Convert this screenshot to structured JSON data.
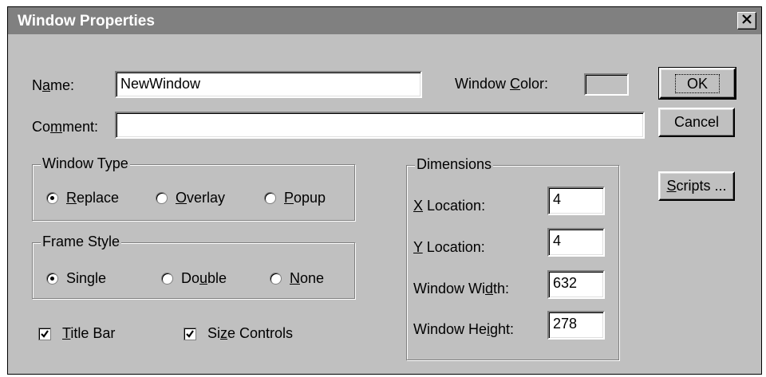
{
  "window": {
    "title": "Window Properties",
    "close_glyph": "✕"
  },
  "name": {
    "label_pre": "N",
    "label_u": "a",
    "label_post": "me:",
    "value": "NewWindow"
  },
  "window_color": {
    "label_pre": "Window ",
    "label_u": "C",
    "label_post": "olor:",
    "color": "#c0c0c0"
  },
  "comment": {
    "label_pre": "Co",
    "label_u": "m",
    "label_post": "ment:",
    "value": ""
  },
  "buttons": {
    "ok": "OK",
    "cancel": "Cancel",
    "scripts_u": "S",
    "scripts_post": "cripts ..."
  },
  "window_type": {
    "title": "Window Type",
    "selected": "Replace",
    "options": [
      {
        "u": "R",
        "post": "eplace"
      },
      {
        "u": "O",
        "post": "verlay"
      },
      {
        "u": "P",
        "post": "opup"
      }
    ]
  },
  "frame_style": {
    "title": "Frame Style",
    "selected": "Single",
    "options": [
      {
        "pre": "Single",
        "u": "",
        "post": ""
      },
      {
        "pre": "Do",
        "u": "u",
        "post": "ble"
      },
      {
        "pre": "",
        "u": "N",
        "post": "one"
      }
    ]
  },
  "checkboxes": {
    "title_bar": {
      "u": "T",
      "post": "itle Bar",
      "checked": true
    },
    "size_controls": {
      "pre": "Si",
      "u": "z",
      "post": "e Controls",
      "checked": true
    }
  },
  "dimensions": {
    "title": "Dimensions",
    "x_location": {
      "u": "X",
      "post": " Location:",
      "value": "4"
    },
    "y_location": {
      "u": "Y",
      "post": " Location:",
      "value": "4"
    },
    "width": {
      "pre": "Window Wi",
      "u": "d",
      "post": "th:",
      "value": "632"
    },
    "height": {
      "pre": "Window He",
      "u": "i",
      "post": "ght:",
      "value": "278"
    }
  }
}
